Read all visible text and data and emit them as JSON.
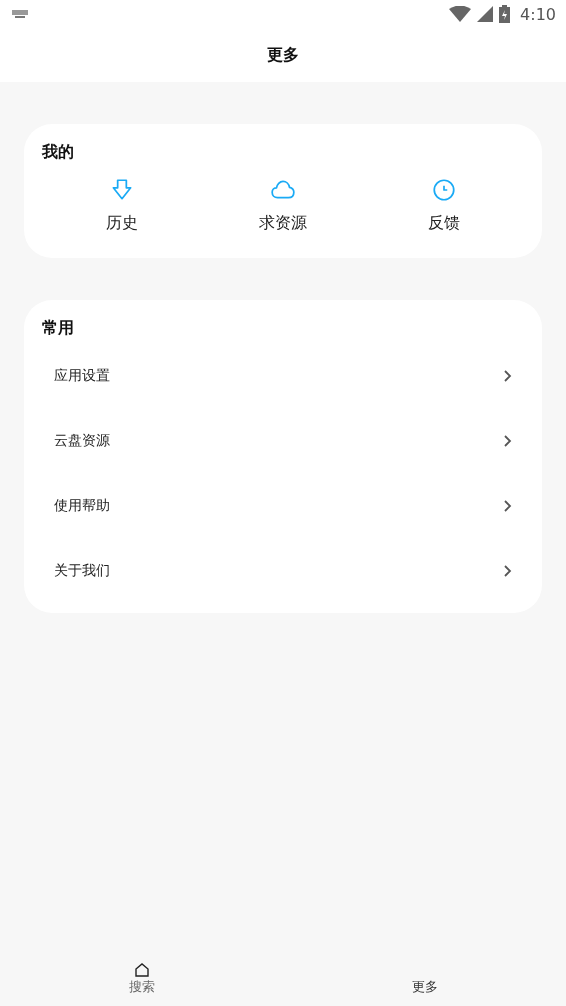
{
  "status_bar": {
    "time": "4:10"
  },
  "header": {
    "title": "更多"
  },
  "mine": {
    "title": "我的",
    "items": [
      {
        "kind": "download",
        "label": "历史"
      },
      {
        "kind": "cloud",
        "label": "求资源"
      },
      {
        "kind": "clock",
        "label": "反馈"
      }
    ]
  },
  "common": {
    "title": "常用",
    "items": [
      {
        "label": "应用设置"
      },
      {
        "label": "云盘资源"
      },
      {
        "label": "使用帮助"
      },
      {
        "label": "关于我们"
      }
    ]
  },
  "bottom_nav": [
    {
      "kind": "home",
      "label": "搜索",
      "selected": false
    },
    {
      "kind": "none",
      "label": "更多",
      "selected": true
    }
  ]
}
